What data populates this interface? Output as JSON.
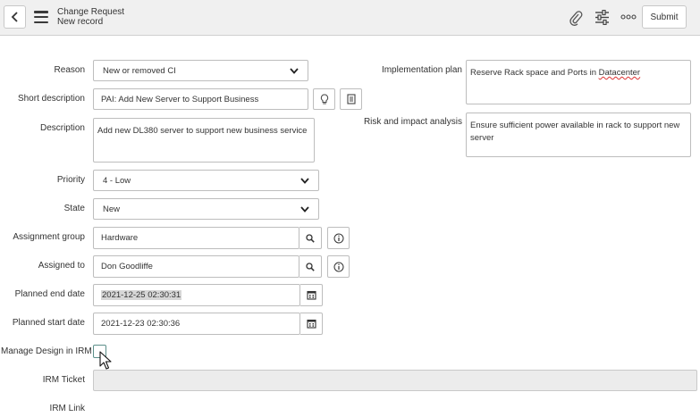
{
  "header": {
    "title": "Change Request",
    "subtitle": "New record",
    "submit_label": "Submit",
    "icons": [
      "chevron-left-icon",
      "hamburger-menu-icon",
      "paperclip-icon",
      "sliders-icon",
      "more-options-icon"
    ]
  },
  "form": {
    "reason": {
      "label": "Reason",
      "value": "New or removed CI"
    },
    "short_description": {
      "label": "Short description",
      "value": "PAI: Add New Server to Support Business"
    },
    "description": {
      "label": "Description",
      "value": "Add new DL380 server to support new business service"
    },
    "priority": {
      "label": "Priority",
      "value": "4 - Low"
    },
    "state": {
      "label": "State",
      "value": "New"
    },
    "assignment_group": {
      "label": "Assignment group",
      "value": "Hardware"
    },
    "assigned_to": {
      "label": "Assigned to",
      "value": "Don Goodliffe"
    },
    "planned_end_date": {
      "label": "Planned end date",
      "value": "2021-12-25 02:30:31"
    },
    "planned_start_date": {
      "label": "Planned start date",
      "value": "2021-12-23 02:30:36"
    },
    "manage_design": {
      "label": "Manage Design in IRM",
      "checked": false
    },
    "irm_ticket": {
      "label": "IRM Ticket",
      "value": ""
    },
    "irm_link": {
      "label": "IRM Link"
    },
    "implementation_plan": {
      "label": "Implementation plan",
      "value_prefix": "Reserve Rack space and Ports in ",
      "value_misspelled": "Datacenter"
    },
    "risk_analysis": {
      "label": "Risk and impact analysis",
      "value": "Ensure sufficient power  available in rack to support new server"
    }
  },
  "colors": {
    "header_bg": "#f0f0f0",
    "checkbox_border": "#5c8f8a",
    "readonly_bg": "#ececec"
  }
}
